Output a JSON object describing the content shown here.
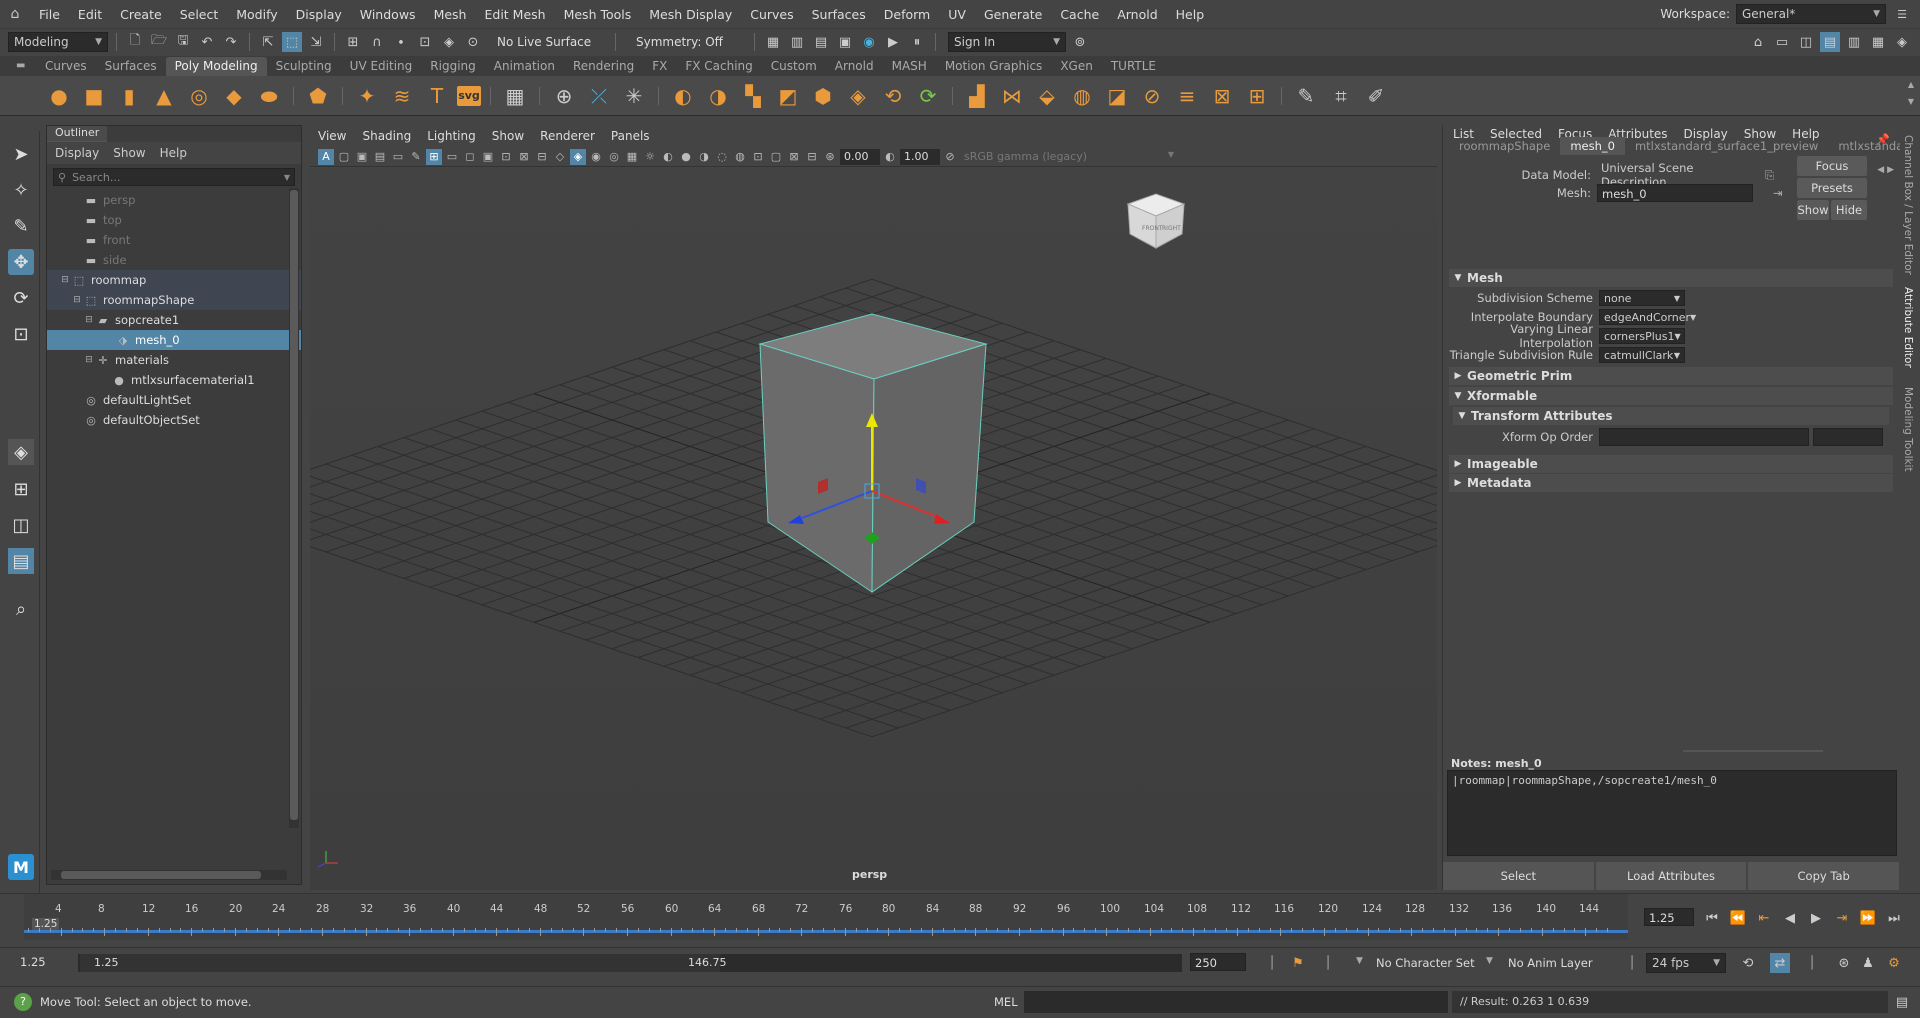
{
  "menubar": {
    "items": [
      "File",
      "Edit",
      "Create",
      "Select",
      "Modify",
      "Display",
      "Windows",
      "Mesh",
      "Edit Mesh",
      "Mesh Tools",
      "Mesh Display",
      "Curves",
      "Surfaces",
      "Deform",
      "UV",
      "Generate",
      "Cache",
      "Arnold",
      "Help"
    ],
    "workspace_label": "Workspace:",
    "workspace_value": "General*"
  },
  "statusline": {
    "mode": "Modeling",
    "live_surface": "No Live Surface",
    "symmetry": "Symmetry: Off",
    "sign_in": "Sign In"
  },
  "shelf": {
    "tabs": [
      "Curves",
      "Surfaces",
      "Poly Modeling",
      "Sculpting",
      "UV Editing",
      "Rigging",
      "Animation",
      "Rendering",
      "FX",
      "FX Caching",
      "Custom",
      "Arnold",
      "MASH",
      "Motion Graphics",
      "XGen",
      "TURTLE"
    ],
    "active_tab": "Poly Modeling",
    "svg_label": "svg"
  },
  "outliner": {
    "title": "Outliner",
    "menu": [
      "Display",
      "Show",
      "Help"
    ],
    "search_placeholder": "Search...",
    "items": [
      "persp",
      "top",
      "front",
      "side",
      "roommap",
      "roommapShape",
      "sopcreate1",
      "mesh_0",
      "materials",
      "mtlxsurfacematerial1",
      "defaultLightSet",
      "defaultObjectSet"
    ]
  },
  "viewport": {
    "menu": [
      "View",
      "Shading",
      "Lighting",
      "Show",
      "Renderer",
      "Panels"
    ],
    "exposure": "0.00",
    "gamma": "1.00",
    "colorspace": "sRGB gamma (legacy)",
    "camera_label": "persp",
    "viewcube_front": "FRONT",
    "viewcube_right": "RIGHT"
  },
  "attribute_editor": {
    "menu": [
      "List",
      "Selected",
      "Focus",
      "Attributes",
      "Display",
      "Show",
      "Help"
    ],
    "tabs": [
      "roommapShape",
      "mesh_0",
      "mtlxstandard_surface1_preview",
      "mtlxstandard_su"
    ],
    "active_tab": "mesh_0",
    "data_model_label": "Data Model:",
    "data_model_value": "Universal Scene Description",
    "mesh_label": "Mesh:",
    "mesh_value": "mesh_0",
    "focus_btn": "Focus",
    "presets_btn": "Presets",
    "show_btn": "Show",
    "hide_btn": "Hide",
    "sections": {
      "mesh": "Mesh",
      "geometric_prim": "Geometric Prim",
      "xformable": "Xformable",
      "transform_attributes": "Transform Attributes",
      "imageable": "Imageable",
      "metadata": "Metadata"
    },
    "fields": [
      {
        "label": "Subdivision Scheme",
        "value": "none"
      },
      {
        "label": "Interpolate Boundary",
        "value": "edgeAndCorner"
      },
      {
        "label": "Varying Linear Interpolation",
        "value": "cornersPlus1"
      },
      {
        "label": "Triangle Subdivision Rule",
        "value": "catmullClark"
      }
    ],
    "xform_op_order_label": "Xform Op Order",
    "notes_label": "Notes:  mesh_0",
    "notes_text": "|roommap|roommapShape,/sopcreate1/mesh_0",
    "buttons": [
      "Select",
      "Load Attributes",
      "Copy Tab"
    ]
  },
  "side_tabs": [
    "Channel Box / Layer Editor",
    "Attribute Editor",
    "Modeling Toolkit"
  ],
  "timeslider": {
    "ticks": [
      "4",
      "8",
      "12",
      "16",
      "20",
      "24",
      "28",
      "32",
      "36",
      "40",
      "44",
      "48",
      "52",
      "56",
      "60",
      "64",
      "68",
      "72",
      "76",
      "80",
      "84",
      "88",
      "92",
      "96",
      "100",
      "104",
      "108",
      "112",
      "116",
      "120",
      "124",
      "128",
      "132",
      "136",
      "140",
      "144"
    ],
    "current_frame": "1.25",
    "current_frame_field": "1.25"
  },
  "rangeslider": {
    "start": "1.25",
    "range_start": "1.25",
    "range_end": "146.75",
    "end": "250",
    "character_set": "No Character Set",
    "anim_layer": "No Anim Layer",
    "fps": "24 fps"
  },
  "commandline": {
    "help_text": "Move Tool: Select an object to move.",
    "lang": "MEL",
    "result": "// Result: 0.263 1 0.639"
  },
  "colors": {
    "accent_selection": "#5285a6",
    "shelf_icon": "#e89a3c",
    "timeline_marker": "#3a7ac6"
  }
}
